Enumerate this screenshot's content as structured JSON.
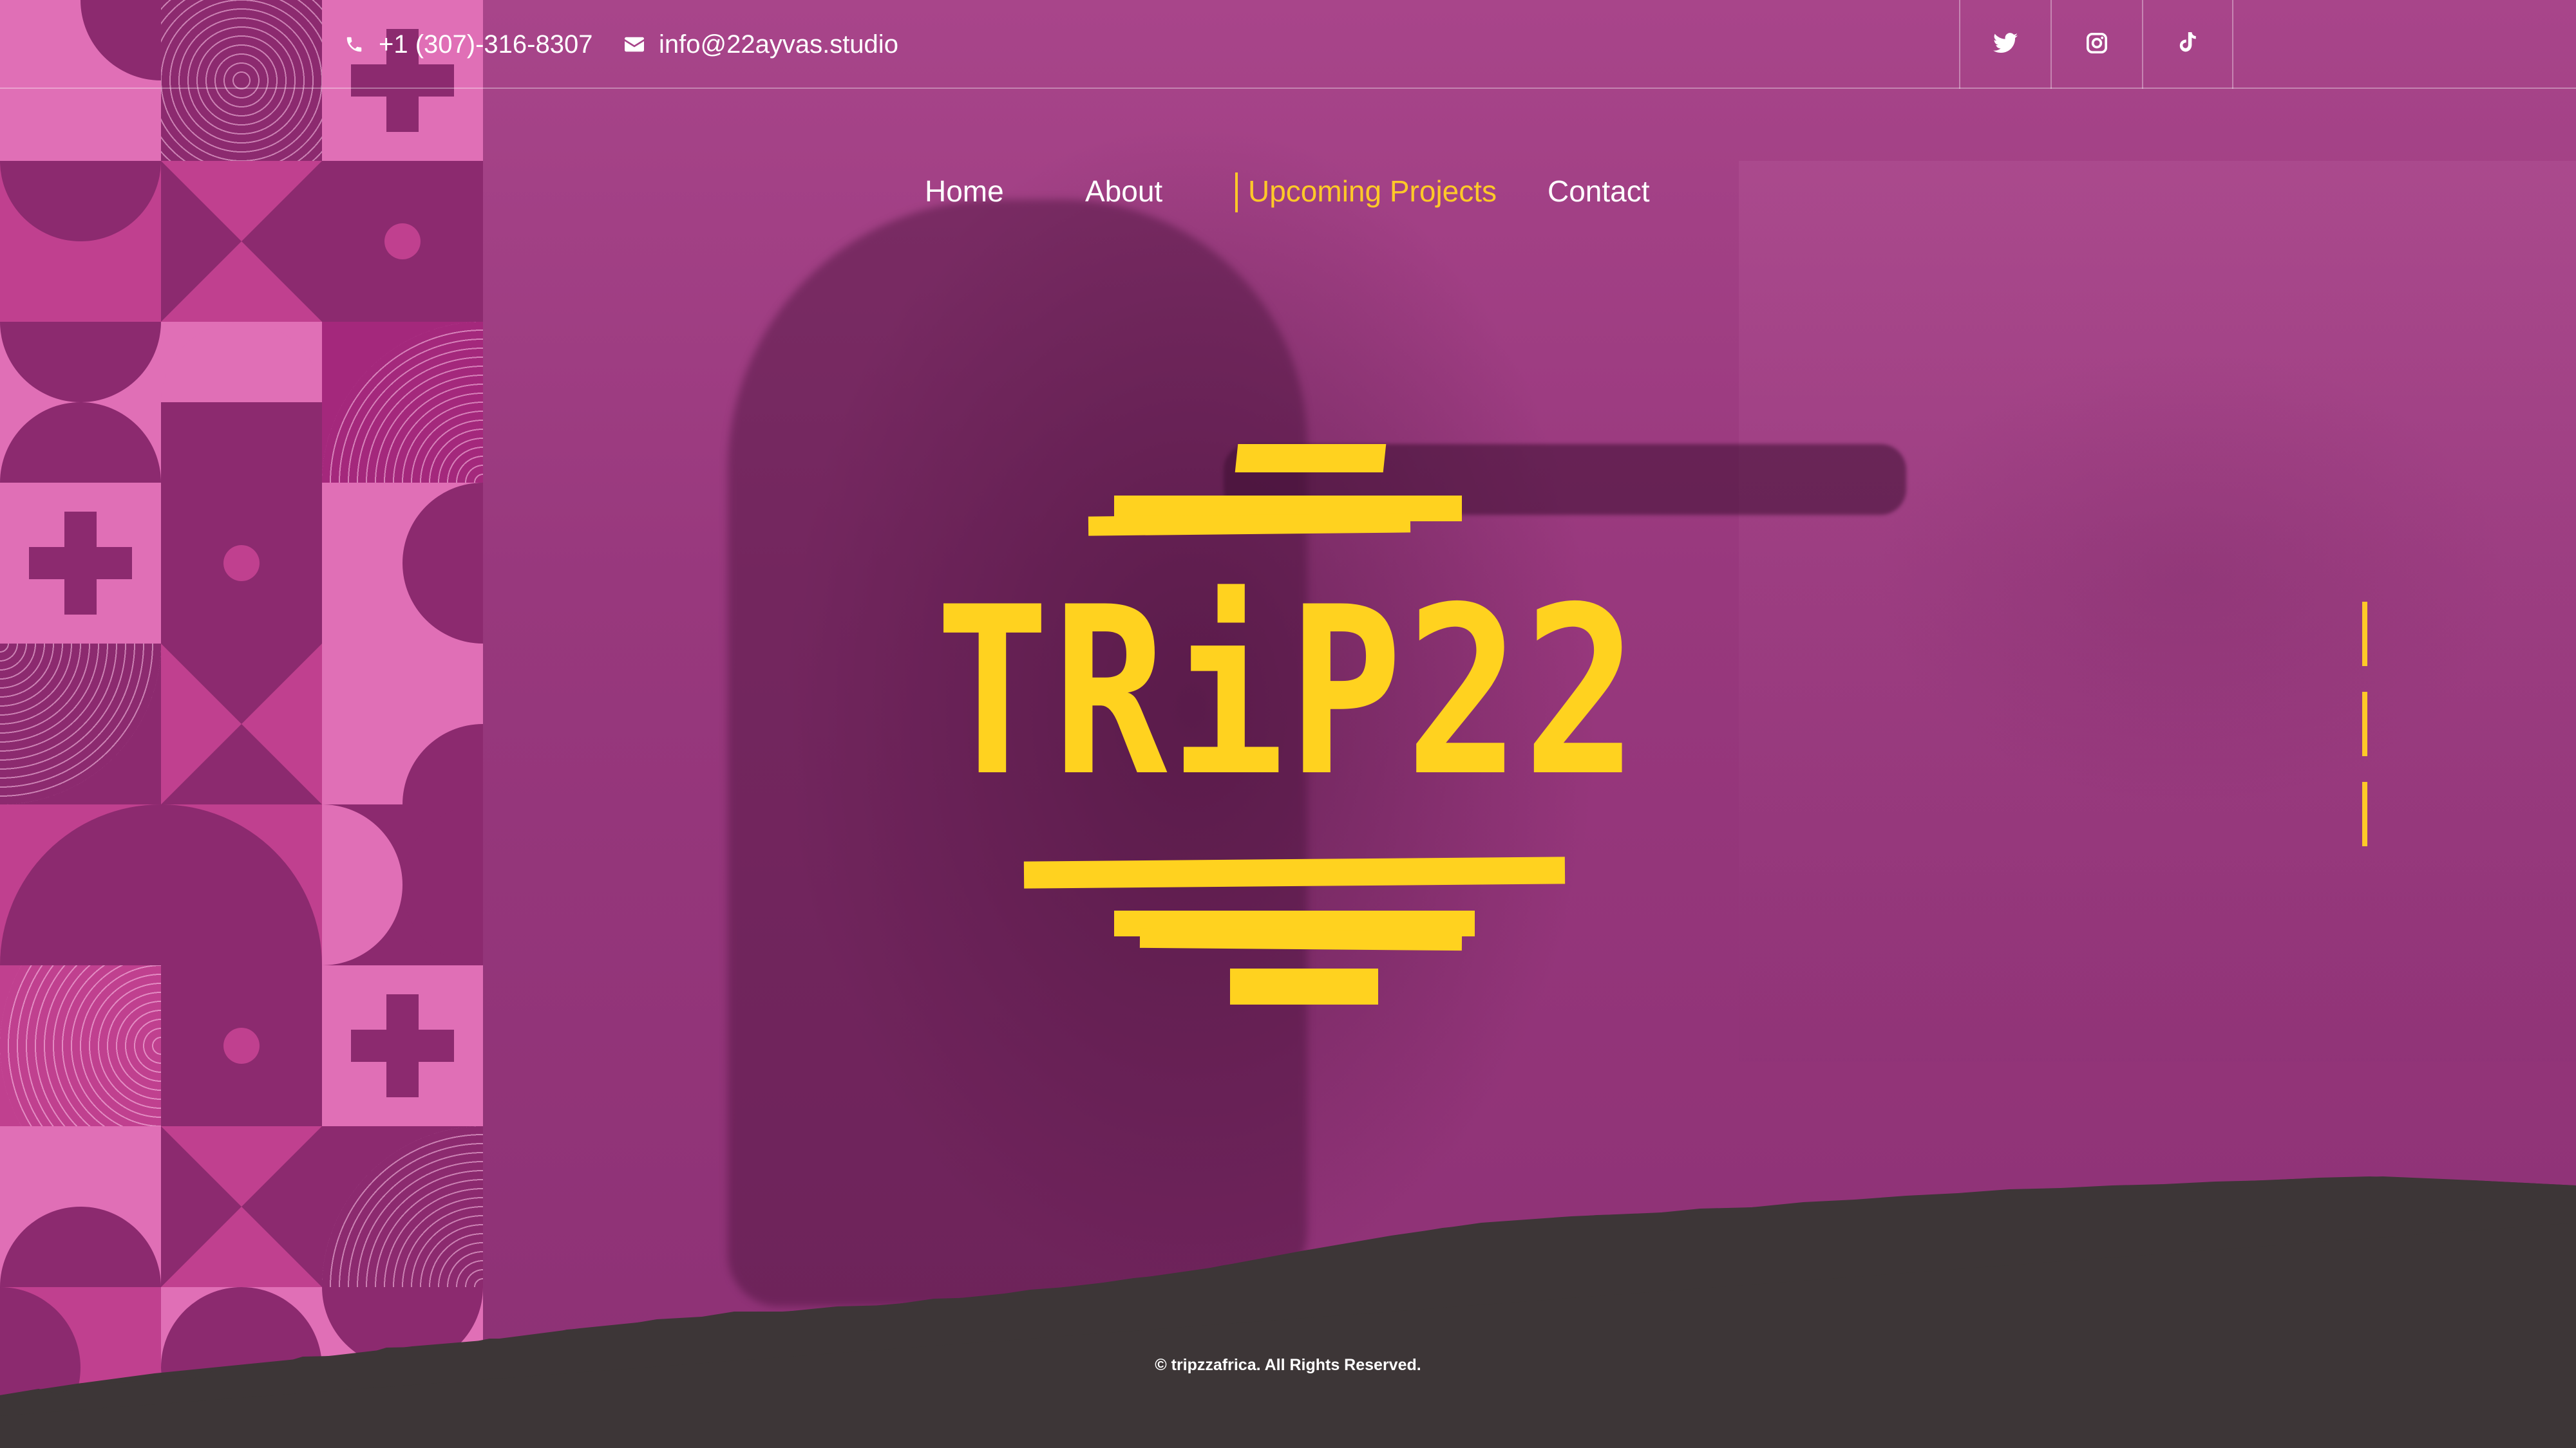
{
  "topbar": {
    "phone": "+1 (307)-316-8307",
    "email": "info@22ayvas.studio",
    "phone_icon": "phone-icon",
    "email_icon": "envelope-icon",
    "socials": [
      {
        "name": "twitter",
        "icon": "twitter-icon"
      },
      {
        "name": "instagram",
        "icon": "instagram-icon"
      },
      {
        "name": "tiktok",
        "icon": "tiktok-icon"
      }
    ]
  },
  "nav": {
    "items": [
      "Home",
      "About",
      "Upcoming Projects",
      "Contact"
    ],
    "active": "Upcoming Projects"
  },
  "hero": {
    "logo_text": "TRiP22"
  },
  "footer": {
    "copyright": "© tripzzafrica. All Rights Reserved."
  },
  "colors": {
    "background_magenta": "#9a3a7e",
    "accent_yellow": "#ffc928",
    "logo_yellow": "#ffd21f",
    "footer_dark": "#3d3637"
  }
}
